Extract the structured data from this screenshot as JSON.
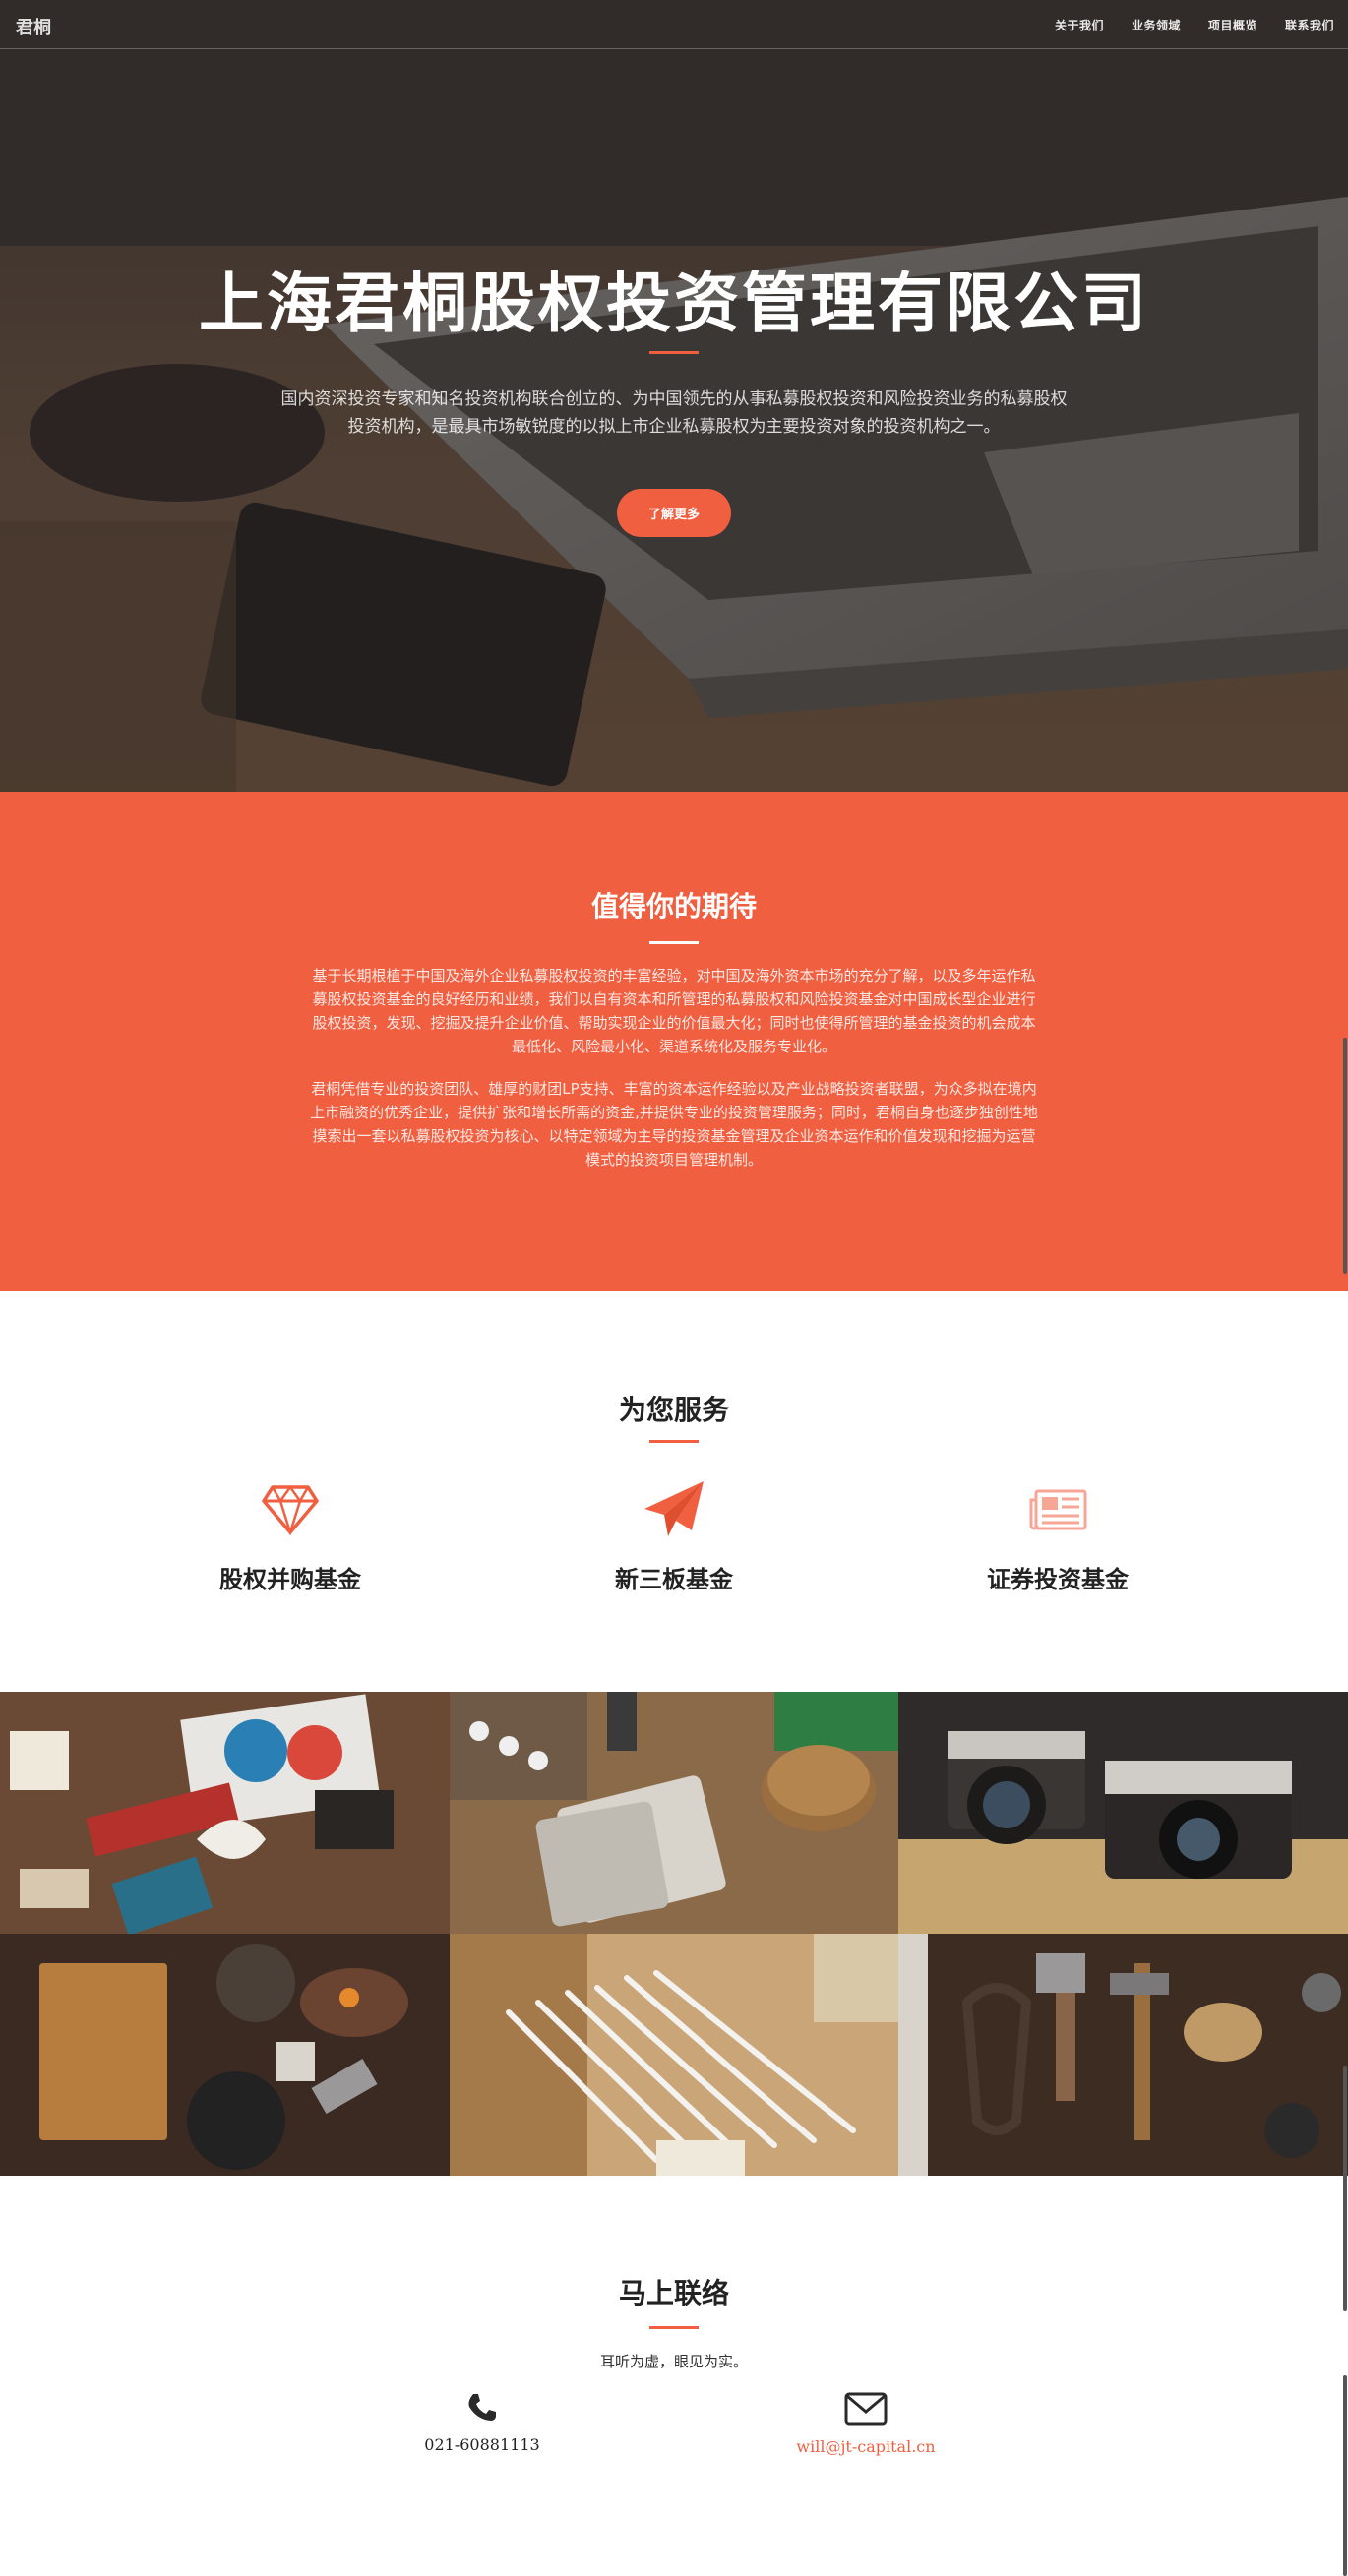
{
  "nav": {
    "brand": "君桐",
    "items": [
      "关于我们",
      "业务领域",
      "项目概览",
      "联系我们"
    ]
  },
  "hero": {
    "title": "上海君桐股权投资管理有限公司",
    "text": "国内资深投资专家和知名投资机构联合创立的、为中国领先的从事私募股权投资和风险投资业务的私募股权投资机构，是最具市场敏锐度的以拟上市企业私募股权为主要投资对象的投资机构之一。",
    "button": "了解更多"
  },
  "about": {
    "title": "值得你的期待",
    "p1": "基于长期根植于中国及海外企业私募股权投资的丰富经验，对中国及海外资本市场的充分了解，以及多年运作私募股权投资基金的良好经历和业绩，我们以自有资本和所管理的私募股权和风险投资基金对中国成长型企业进行股权投资，发现、挖掘及提升企业价值、帮助实现企业的价值最大化；同时也使得所管理的基金投资的机会成本最低化、风险最小化、渠道系统化及服务专业化。",
    "p2": "君桐凭借专业的投资团队、雄厚的财团LP支持、丰富的资本运作经验以及产业战略投资者联盟，为众多拟在境内上市融资的优秀企业，提供扩张和增长所需的资金,并提供专业的投资管理服务；同时，君桐自身也逐步独创性地摸索出一套以私募股权投资为核心、以特定领域为主导的投资基金管理及企业资本运作和价值发现和挖掘为运营模式的投资项目管理机制。"
  },
  "services": {
    "title": "为您服务",
    "items": [
      {
        "label": "股权并购基金",
        "icon": "diamond-icon"
      },
      {
        "label": "新三板基金",
        "icon": "paper-plane-icon"
      },
      {
        "label": "证券投资基金",
        "icon": "newspaper-icon"
      }
    ]
  },
  "portfolio": {
    "tiles": [
      "portfolio-image-1",
      "portfolio-image-2",
      "portfolio-image-3",
      "portfolio-image-4",
      "portfolio-image-5",
      "portfolio-image-6"
    ]
  },
  "contact": {
    "title": "马上联络",
    "subtitle": "耳听为虚，眼见为实。",
    "phone": "021-60881113",
    "email": "will@jt-capital.cn",
    "phone_icon": "phone-icon",
    "email_icon": "envelope-icon"
  },
  "colors": {
    "accent": "#f05f40",
    "dark": "#222222"
  }
}
